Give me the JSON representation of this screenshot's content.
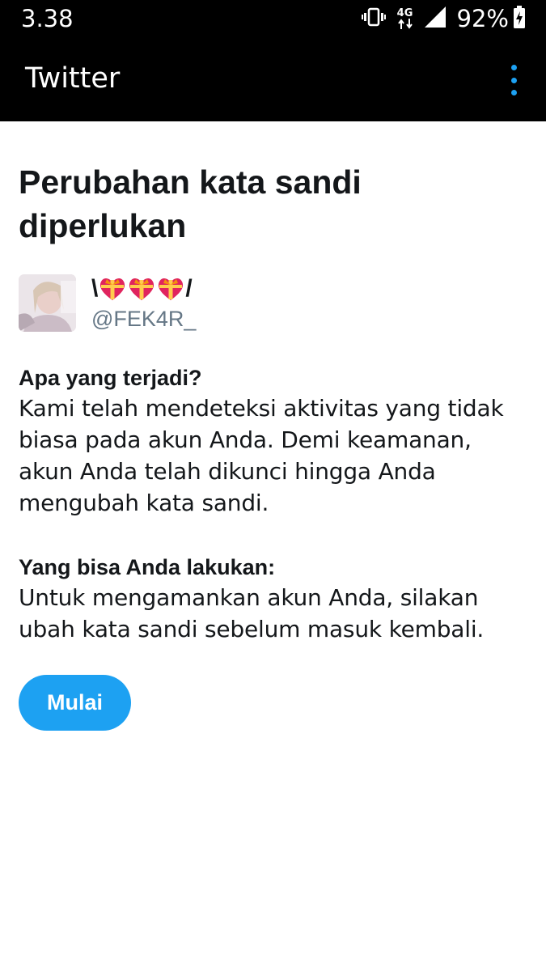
{
  "status_bar": {
    "time": "3.38",
    "network": "4G",
    "battery_percent": "92%"
  },
  "app_bar": {
    "title": "Twitter",
    "menu_icon": "more-vertical-icon",
    "accent_color": "#1da1f2"
  },
  "page": {
    "title": "Perubahan kata sandi diperlukan"
  },
  "profile": {
    "display_name_prefix": "\\",
    "display_name_suffix": "/",
    "display_name_icons": [
      "gift-heart-icon",
      "gift-heart-icon",
      "gift-heart-icon"
    ],
    "handle": "@FEK4R_"
  },
  "sections": [
    {
      "heading": "Apa yang terjadi?",
      "body": "Kami telah mendeteksi aktivitas yang tidak biasa pada akun Anda. Demi keamanan, akun Anda telah dikunci hingga Anda mengubah kata sandi."
    },
    {
      "heading": "Yang bisa Anda lakukan:",
      "body": "Untuk mengamankan akun Anda, silakan ubah kata sandi sebelum masuk kembali."
    }
  ],
  "actions": {
    "start_label": "Mulai"
  }
}
